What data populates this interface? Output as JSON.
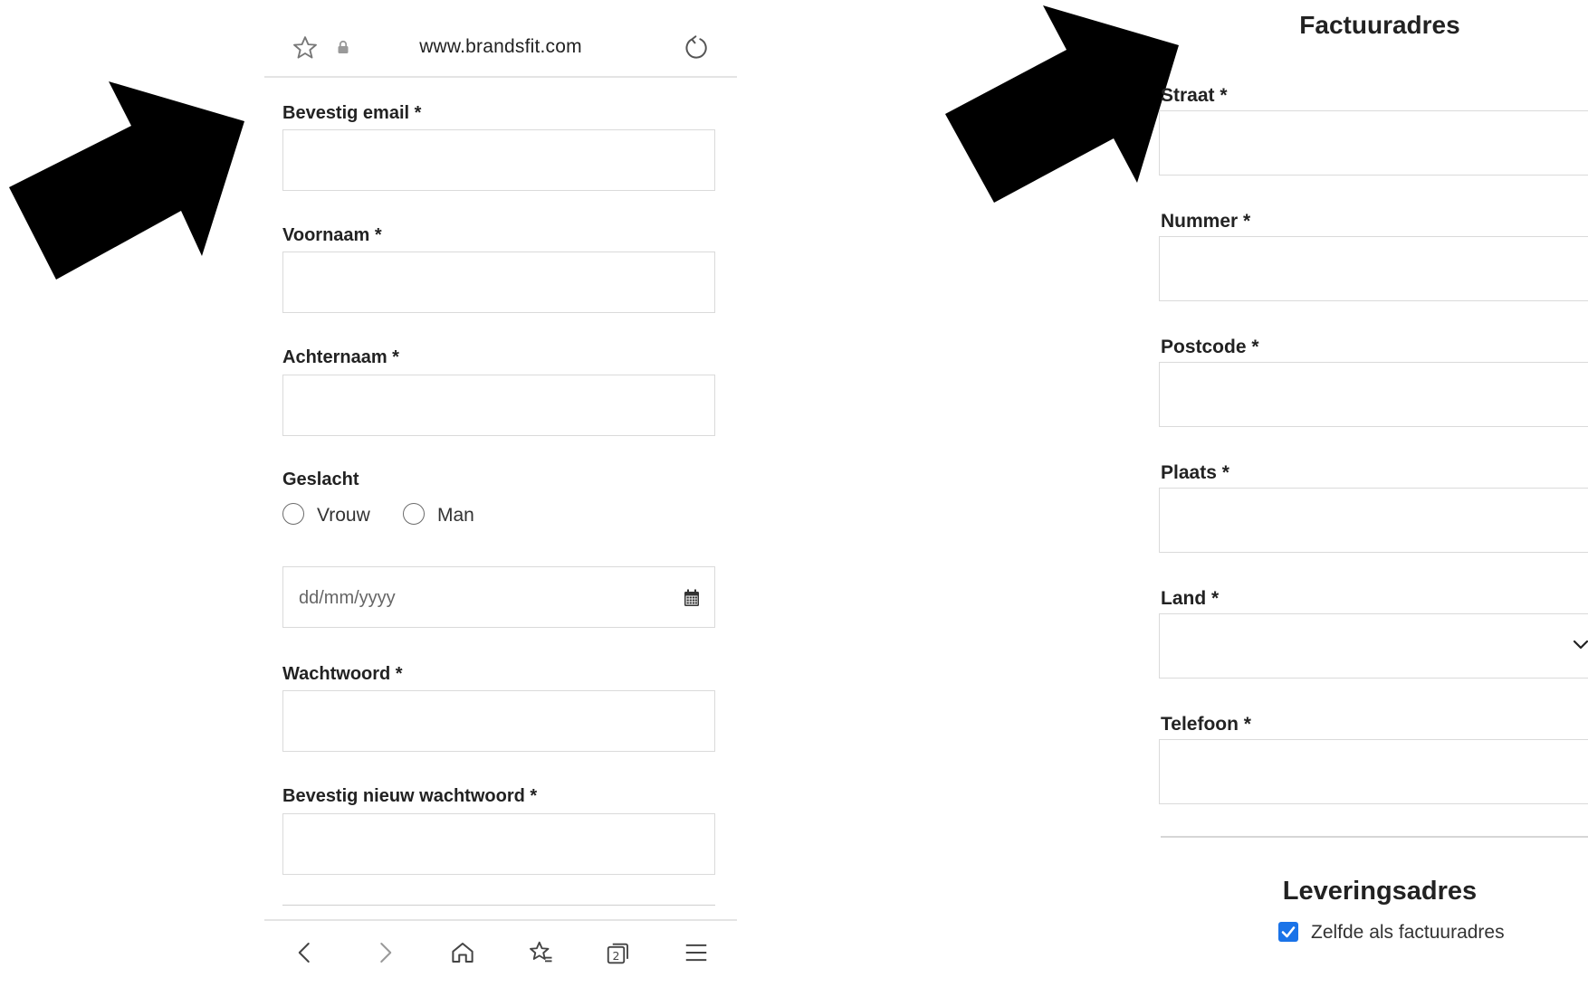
{
  "browser": {
    "url": "www.brandsfit.com"
  },
  "left_form": {
    "confirm_email_label": "Bevestig email *",
    "first_name_label": "Voornaam *",
    "last_name_label": "Achternaam *",
    "gender_label": "Geslacht",
    "gender_options": [
      "Vrouw",
      "Man"
    ],
    "birthdate_placeholder": "dd/mm/yyyy",
    "password_label": "Wachtwoord *",
    "confirm_password_label": "Bevestig nieuw wachtwoord *"
  },
  "right_form": {
    "billing_title": "Factuuradres",
    "street_label": "Straat  *",
    "number_label": "Nummer *",
    "postcode_label": "Postcode *",
    "city_label": "Plaats *",
    "country_label": "Land *",
    "phone_label": "Telefoon *",
    "delivery_title": "Leveringsadres",
    "same_as_billing_label": "Zelfde als factuuradres",
    "same_as_billing_checked": true
  },
  "icons": {
    "bookmark": "star-outline-icon",
    "secure": "lock-icon",
    "reload": "reload-icon",
    "date": "calendar-icon",
    "country_dropdown": "chevron-down-icon",
    "back": "chevron-left-icon",
    "forward": "chevron-right-icon",
    "home": "home-icon",
    "bookmarks": "bookmarks-icon",
    "tabs": "tabs-icon",
    "tab_count": "2",
    "menu": "hamburger-menu-icon",
    "annotation_arrow": "arrow-annotation-icon"
  },
  "colors": {
    "checkbox": "#1a73e8",
    "arrow": "#000000"
  }
}
